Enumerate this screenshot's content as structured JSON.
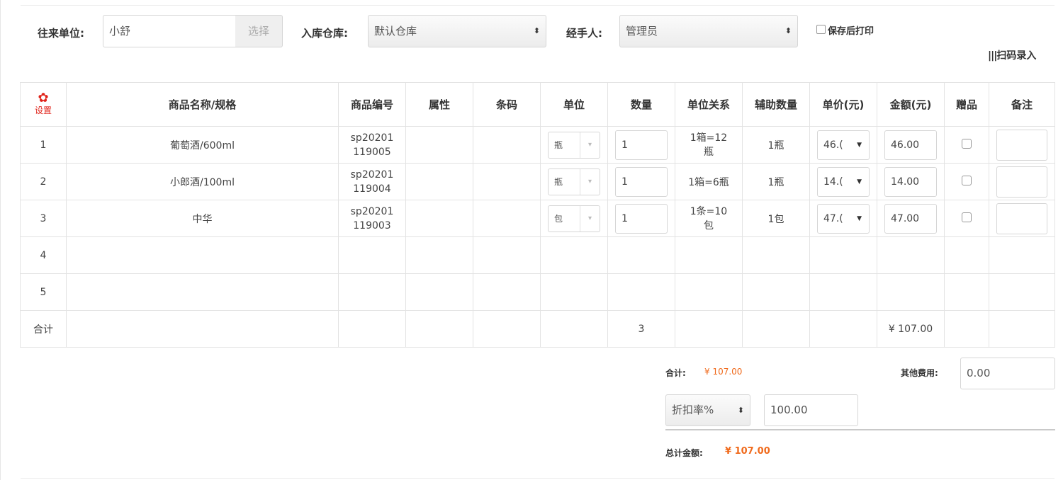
{
  "header": {
    "partner_label": "往来单位:",
    "partner_value": "小舒",
    "select_button": "选择",
    "warehouse_label": "入库仓库:",
    "warehouse_value": "默认仓库",
    "handler_label": "经手人:",
    "handler_value": "管理员",
    "print_after_save": "保存后打印",
    "scan_entry": "扫码录入"
  },
  "table": {
    "settings_label": "设置",
    "columns": [
      "商品名称/规格",
      "商品编号",
      "属性",
      "条码",
      "单位",
      "数量",
      "单位关系",
      "辅助数量",
      "单价(元)",
      "金额(元)",
      "赠品",
      "备注"
    ],
    "rows": [
      {
        "num": "1",
        "name": "葡萄酒/600ml",
        "code_a": "sp20201",
        "code_b": "119005",
        "unit": "瓶",
        "qty": "1",
        "rel_a": "1箱=12",
        "rel_b": "瓶",
        "aux": "1瓶",
        "price": "46.(",
        "amount": "46.00"
      },
      {
        "num": "2",
        "name": "小郎酒/100ml",
        "code_a": "sp20201",
        "code_b": "119004",
        "unit": "瓶",
        "qty": "1",
        "rel_a": "1箱=6瓶",
        "rel_b": "",
        "aux": "1瓶",
        "price": "14.(",
        "amount": "14.00"
      },
      {
        "num": "3",
        "name": "中华",
        "code_a": "sp20201",
        "code_b": "119003",
        "unit": "包",
        "qty": "1",
        "rel_a": "1条=10",
        "rel_b": "包",
        "aux": "1包",
        "price": "47.(",
        "amount": "47.00"
      },
      {
        "num": "4"
      },
      {
        "num": "5"
      }
    ],
    "total_label": "合计",
    "total_qty": "3",
    "total_amount": "¥ 107.00"
  },
  "summary": {
    "total_label": "合计:",
    "total_value": "¥ 107.00",
    "other_fee_label": "其他费用:",
    "other_fee_value": "0.00",
    "discount_select": "折扣率%",
    "discount_value": "100.00",
    "grand_total_label": "总计金额:",
    "grand_total_value": "¥ 107.00"
  }
}
